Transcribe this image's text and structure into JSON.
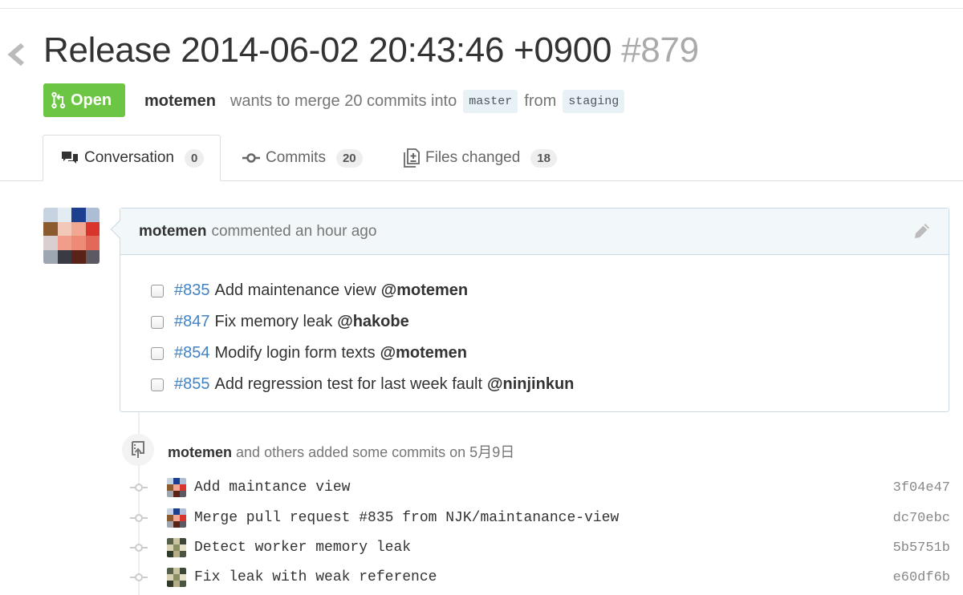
{
  "pr": {
    "title": "Release 2014-06-02 20:43:46 +0900",
    "number": "#879",
    "state": "Open",
    "author": "motemen",
    "merge_text": "wants to merge 20 commits into",
    "base_branch": "master",
    "from_text": "from",
    "head_branch": "staging"
  },
  "tabs": [
    {
      "label": "Conversation",
      "count": "0",
      "icon": "comment-discussion-icon"
    },
    {
      "label": "Commits",
      "count": "20",
      "icon": "git-commit-icon"
    },
    {
      "label": "Files changed",
      "count": "18",
      "icon": "diff-icon"
    }
  ],
  "comment": {
    "author": "motemen",
    "meta": "commented an hour ago",
    "tasks": [
      {
        "issue": "#835",
        "text": "Add maintenance view",
        "mention": "@motemen",
        "checked": false
      },
      {
        "issue": "#847",
        "text": "Fix memory leak",
        "mention": "@hakobe",
        "checked": false
      },
      {
        "issue": "#854",
        "text": "Modify login form texts",
        "mention": "@motemen",
        "checked": false
      },
      {
        "issue": "#855",
        "text": "Add regression test for last week fault",
        "mention": "@ninjinkun",
        "checked": false
      }
    ]
  },
  "commits_header": {
    "author": "motemen",
    "text": "and others added some commits on 5月9日"
  },
  "commits": [
    {
      "message": "Add maintance view",
      "sha": "3f04e47",
      "avatar": "pixel-avatar-red"
    },
    {
      "message": "Merge pull request #835 from NJK/maintanance-view",
      "sha": "dc70ebc",
      "avatar": "pixel-avatar-red"
    },
    {
      "message": "Detect worker memory leak",
      "sha": "5b5751b",
      "avatar": "pixel-avatar-green"
    },
    {
      "message": "Fix leak with weak reference",
      "sha": "e60df6b",
      "avatar": "pixel-avatar-green"
    }
  ],
  "colors": {
    "open_green": "#6cc644",
    "link_blue": "#4183c4",
    "branch_bg": "#e8f1f6",
    "comment_header_bg": "#f2f8fa",
    "comment_border": "#cad9e6"
  }
}
